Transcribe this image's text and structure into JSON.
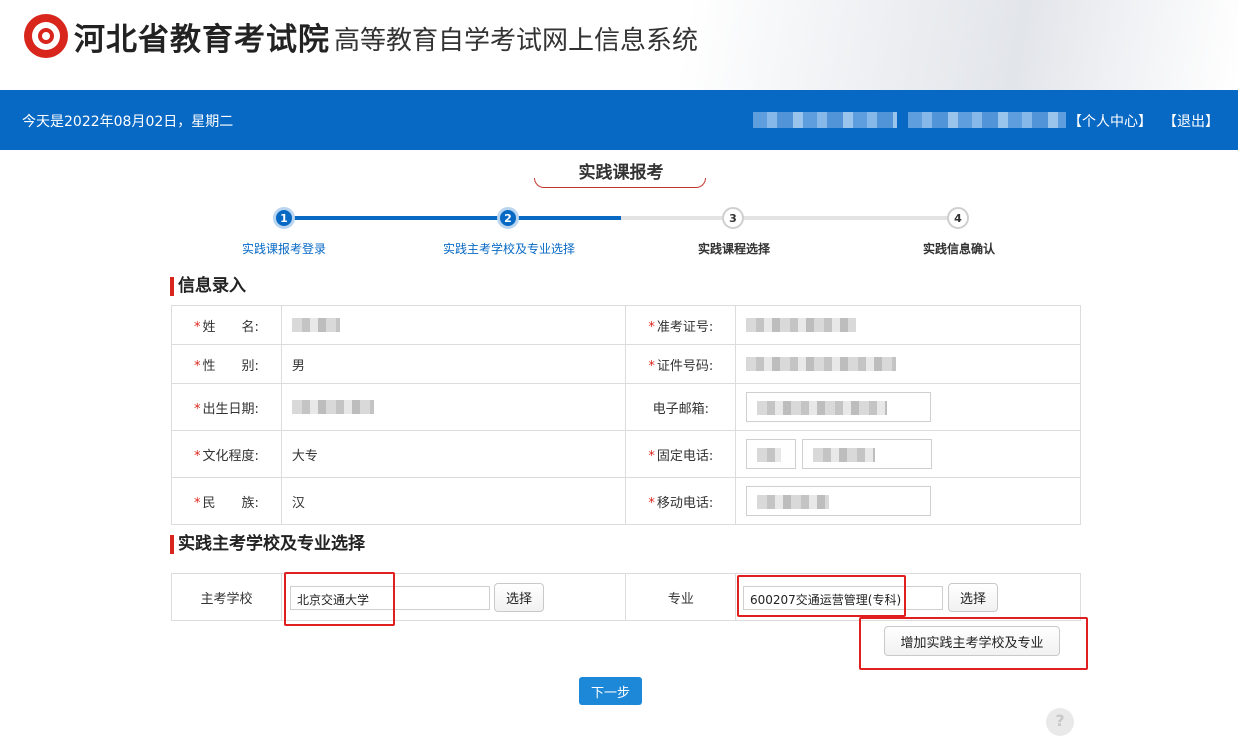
{
  "header": {
    "org_title": "河北省教育考试院",
    "system_title": "高等教育自学考试网上信息系统"
  },
  "topbar": {
    "date_text": "今天是2022年08月02日，星期二",
    "personal_center": "【个人中心】",
    "logout": "【退出】"
  },
  "page": {
    "heading": "实践课报考"
  },
  "steps": [
    {
      "num": "1",
      "label": "实践课报考登录",
      "state": "done"
    },
    {
      "num": "2",
      "label": "实践主考学校及专业选择",
      "state": "current"
    },
    {
      "num": "3",
      "label": "实践课程选择",
      "state": "todo"
    },
    {
      "num": "4",
      "label": "实践信息确认",
      "state": "todo"
    }
  ],
  "info": {
    "section_title": "信息录入",
    "required_mark": "*",
    "name_label": "姓　　名:",
    "exam_no_label": "准考证号:",
    "gender_label": "性　　别:",
    "gender_value": "男",
    "id_no_label": "证件号码:",
    "birth_label": "出生日期:",
    "email_label": "电子邮箱:",
    "education_label": "文化程度:",
    "education_value": "大专",
    "phone_label": "固定电话:",
    "ethnic_label": "民　　族:",
    "ethnic_value": "汉",
    "mobile_label": "移动电话:"
  },
  "selection": {
    "section_title": "实践主考学校及专业选择",
    "school_label": "主考学校",
    "school_value": "北京交通大学",
    "school_select": "选择",
    "major_label": "专业",
    "major_value": "600207交通运营管理(专科)",
    "major_select": "选择",
    "add_button": "增加实践主考学校及专业"
  },
  "footer": {
    "next_button": "下一步",
    "help_icon_text": "?"
  },
  "colors": {
    "primary_blue": "#0869c5",
    "accent_red": "#d9261c",
    "highlight_red": "#e02020",
    "next_button_blue": "#1e88d8"
  }
}
